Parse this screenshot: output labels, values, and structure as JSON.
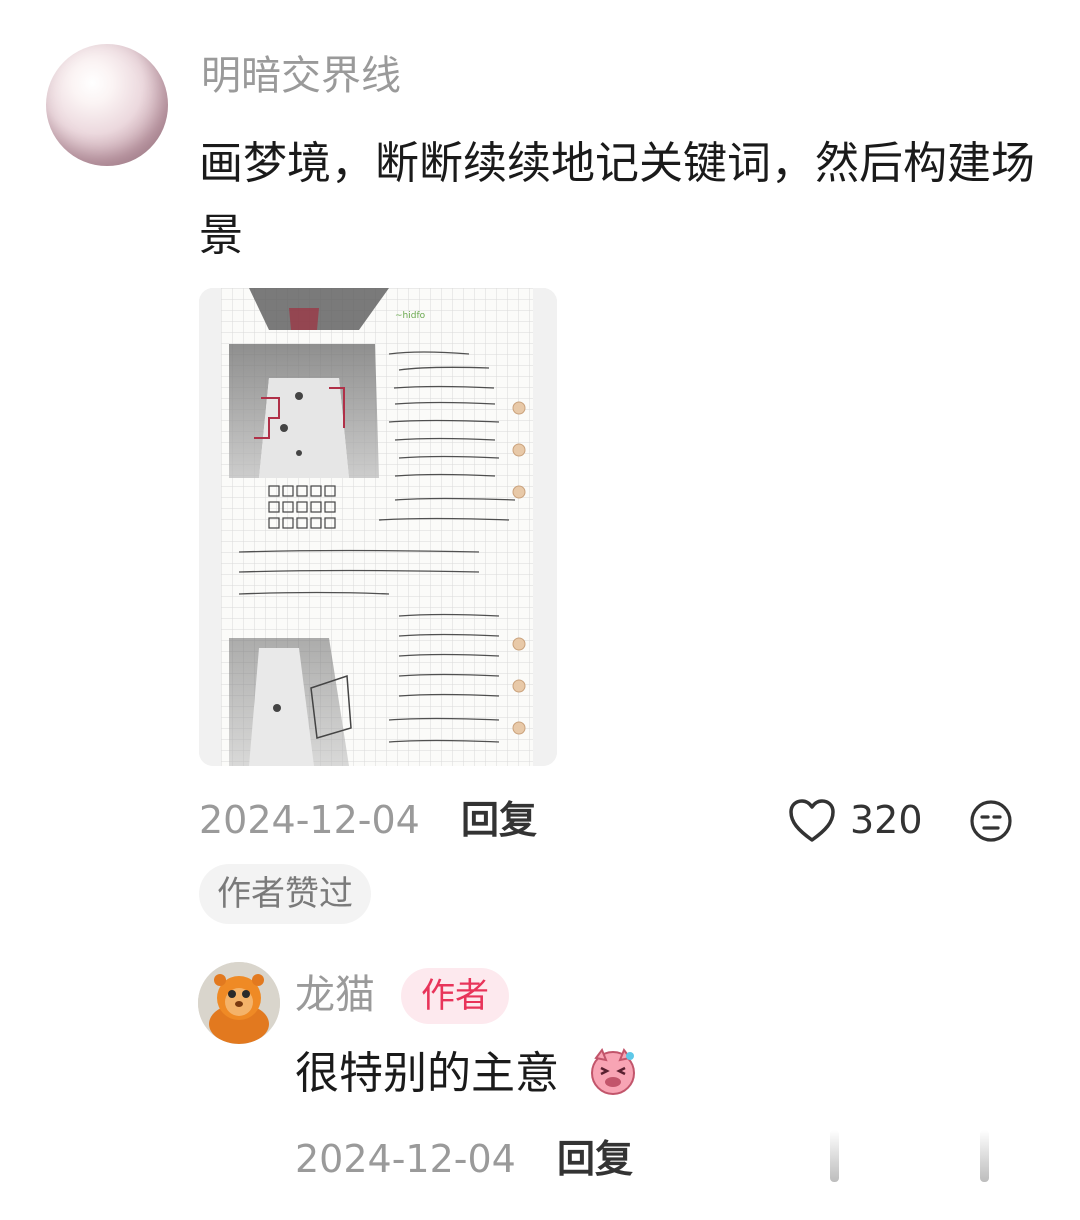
{
  "comment": {
    "username": "明暗交界线",
    "text": "画梦境，断断续续地记关键词，然后构建场景",
    "date": "2024-12-04",
    "reply_label": "回复",
    "like_count": "320",
    "author_liked_tag": "作者赞过"
  },
  "reply": {
    "username": "龙猫",
    "author_badge": "作者",
    "text": "很特别的主意",
    "date": "2024-12-04",
    "reply_label": "回复"
  },
  "colors": {
    "accent": "#e8345a",
    "muted_text": "#9a9a9a",
    "primary_text": "#1a1a1a"
  },
  "icons": [
    "heart-icon",
    "neutral-face-icon",
    "laughing-pig-emoji"
  ]
}
